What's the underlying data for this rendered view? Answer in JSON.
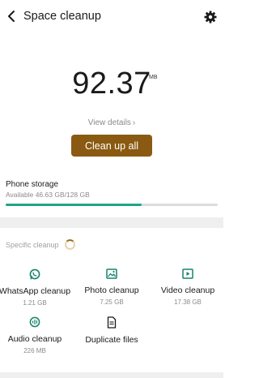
{
  "header": {
    "title": "Space cleanup",
    "back_icon": "arrow-back-icon",
    "settings_icon": "gear-icon"
  },
  "summary": {
    "size_value": "92.37",
    "size_unit": "MB",
    "view_details": "View details",
    "cleanup_button": "Clean up all"
  },
  "storage": {
    "title": "Phone storage",
    "subtitle": "Available 46.63 GB/128 GB",
    "used_fraction": 0.64,
    "bar_color": "#1fa58a"
  },
  "specific": {
    "title": "Specific cleanup",
    "items": [
      {
        "label": "WhatsApp cleanup",
        "size": "1.21 GB",
        "icon": "whatsapp-icon"
      },
      {
        "label": "Photo cleanup",
        "size": "7.25 GB",
        "icon": "photo-icon"
      },
      {
        "label": "Video cleanup",
        "size": "17.38 GB",
        "icon": "video-icon"
      },
      {
        "label": "Audio cleanup",
        "size": "226 MB",
        "icon": "audio-icon"
      },
      {
        "label": "Duplicate files",
        "size": "",
        "icon": "duplicate-file-icon"
      }
    ]
  },
  "colors": {
    "accent": "#8a5a12",
    "progress": "#1fa58a",
    "icon_green": "#16826b"
  }
}
